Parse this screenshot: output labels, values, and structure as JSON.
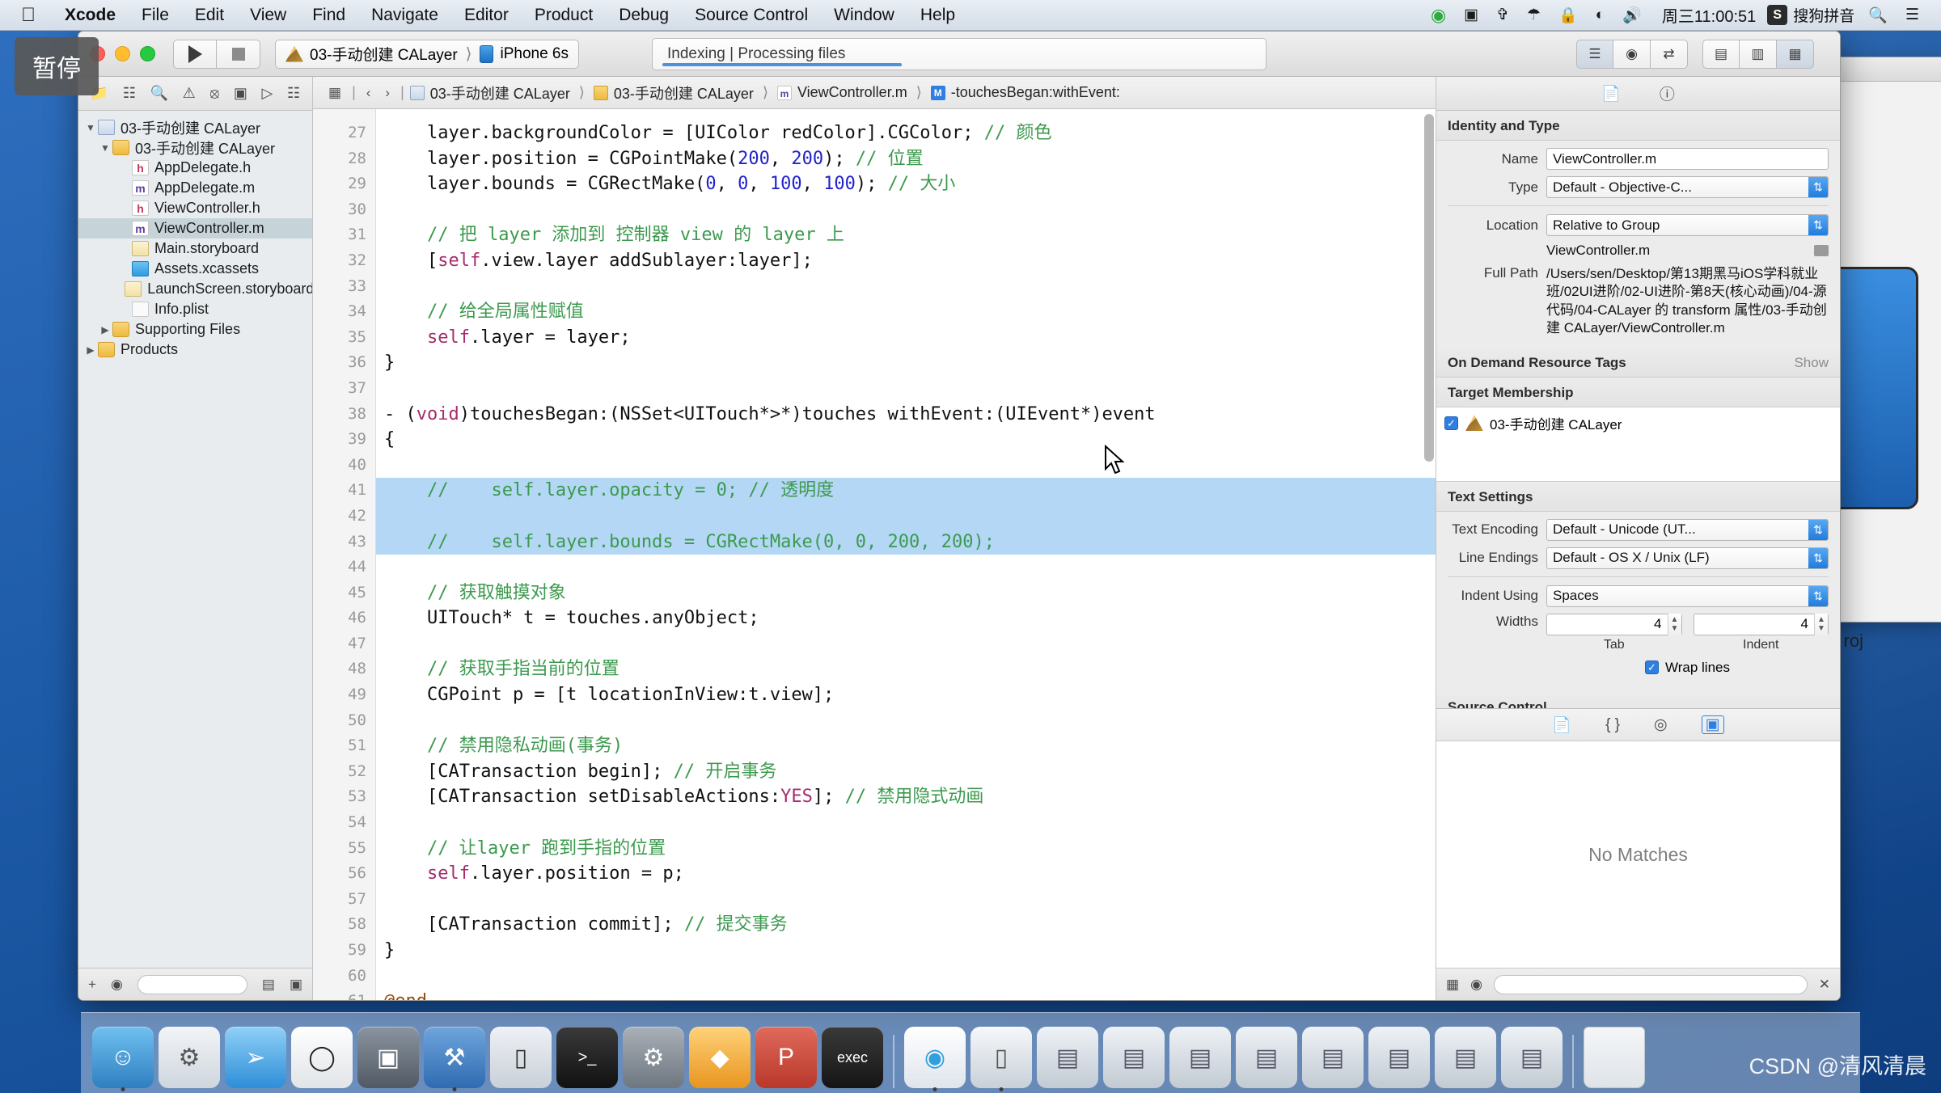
{
  "menubar": {
    "apple_icon": "apple-logo",
    "items": [
      {
        "label": "Xcode",
        "bold": true
      },
      {
        "label": "File",
        "bold": false
      },
      {
        "label": "Edit",
        "bold": false
      },
      {
        "label": "View",
        "bold": false
      },
      {
        "label": "Find",
        "bold": false
      },
      {
        "label": "Navigate",
        "bold": false
      },
      {
        "label": "Editor",
        "bold": false
      },
      {
        "label": "Product",
        "bold": false
      },
      {
        "label": "Debug",
        "bold": false
      },
      {
        "label": "Source Control",
        "bold": false
      },
      {
        "label": "Window",
        "bold": false
      },
      {
        "label": "Help",
        "bold": false
      }
    ],
    "status_icons": [
      "download-icon",
      "screen-record-icon",
      "airplay-icon",
      "bluetooth-icon",
      "lock-icon",
      "wifi-icon",
      "volume-icon"
    ],
    "clock": "周三11:00:51",
    "input_method_badge": "S",
    "input_method": "搜狗拼音",
    "search_icon": "search-icon",
    "control_center_icon": "list-icon"
  },
  "overlay": {
    "pause_label": "暂停"
  },
  "toolbar": {
    "run_icon": "play-icon",
    "stop_icon": "stop-icon",
    "scheme": "03-手动创建 CALayer",
    "scheme_separator": "⟩",
    "destination": "iPhone 6s",
    "status_primary": "Indexing",
    "status_divider": "|",
    "status_secondary": "Processing files",
    "progress_percent": 40,
    "right_segments": [
      {
        "icon": "standard-editor-icon",
        "active": true
      },
      {
        "icon": "assistant-editor-icon",
        "active": false
      },
      {
        "icon": "version-editor-icon",
        "active": false
      }
    ],
    "view_segments": [
      {
        "icon": "hide-navigator-icon",
        "active": false
      },
      {
        "icon": "hide-debug-area-icon",
        "active": false
      },
      {
        "icon": "hide-utilities-icon",
        "active": true
      }
    ]
  },
  "navigator": {
    "tabs": [
      {
        "icon": "folder-icon",
        "name": "project-navigator",
        "active": true
      },
      {
        "icon": "source-control-icon",
        "name": "source-control-navigator",
        "active": false
      },
      {
        "icon": "search-icon",
        "name": "find-navigator",
        "active": false
      },
      {
        "icon": "warning-icon",
        "name": "issue-navigator",
        "active": false
      },
      {
        "icon": "test-icon",
        "name": "test-navigator",
        "active": false
      },
      {
        "icon": "debug-icon",
        "name": "debug-navigator",
        "active": false
      },
      {
        "icon": "breakpoint-icon",
        "name": "breakpoint-navigator",
        "active": false
      },
      {
        "icon": "report-icon",
        "name": "report-navigator",
        "active": false
      }
    ],
    "tree": [
      {
        "label": "03-手动创建 CALayer",
        "indent": 0,
        "twisty": "▼",
        "icon": "proj",
        "glyph": "",
        "selected": false
      },
      {
        "label": "03-手动创建 CALayer",
        "indent": 1,
        "twisty": "▼",
        "icon": "folder",
        "glyph": "",
        "selected": false
      },
      {
        "label": "AppDelegate.h",
        "indent": 2,
        "twisty": "",
        "icon": "txt h",
        "glyph": "h",
        "selected": false
      },
      {
        "label": "AppDelegate.m",
        "indent": 2,
        "twisty": "",
        "icon": "txt m",
        "glyph": "m",
        "selected": false
      },
      {
        "label": "ViewController.h",
        "indent": 2,
        "twisty": "",
        "icon": "txt h",
        "glyph": "h",
        "selected": false
      },
      {
        "label": "ViewController.m",
        "indent": 2,
        "twisty": "",
        "icon": "txt m",
        "glyph": "m",
        "selected": true
      },
      {
        "label": "Main.storyboard",
        "indent": 2,
        "twisty": "",
        "icon": "sb",
        "glyph": "",
        "selected": false
      },
      {
        "label": "Assets.xcassets",
        "indent": 2,
        "twisty": "",
        "icon": "xc",
        "glyph": "",
        "selected": false
      },
      {
        "label": "LaunchScreen.storyboard",
        "indent": 2,
        "twisty": "",
        "icon": "sb",
        "glyph": "",
        "selected": false
      },
      {
        "label": "Info.plist",
        "indent": 2,
        "twisty": "",
        "icon": "plist",
        "glyph": "",
        "selected": false
      },
      {
        "label": "Supporting Files",
        "indent": 1,
        "twisty": "▶",
        "icon": "folder",
        "glyph": "",
        "selected": false
      },
      {
        "label": "Products",
        "indent": 0,
        "twisty": "▶",
        "icon": "folder",
        "glyph": "",
        "selected": false
      }
    ],
    "bottom": {
      "add_icon": "+",
      "filter_icon": "filter-icon",
      "filter_placeholder": "",
      "right_icons": [
        "recent-icon",
        "source-control-filter-icon"
      ]
    }
  },
  "jumpbar": {
    "related_icon": "related-files-icon",
    "back_icon": "‹",
    "forward_icon": "›",
    "crumbs": [
      {
        "label": "03-手动创建 CALayer",
        "icon": "proj",
        "glyph": ""
      },
      {
        "label": "03-手动创建 CALayer",
        "icon": "folder",
        "glyph": ""
      },
      {
        "label": "ViewController.m",
        "icon": "m",
        "glyph": "m"
      },
      {
        "label": "-touchesBegan:withEvent:",
        "icon": "meth",
        "glyph": "M"
      }
    ]
  },
  "editor": {
    "first_line_number": 27,
    "lines": [
      {
        "n": 27,
        "selected": false,
        "segments": [
          {
            "t": "    layer.backgroundColor = [UIColor redColor].CGColor; ",
            "c": ""
          },
          {
            "t": "// 颜色",
            "c": "cm"
          }
        ]
      },
      {
        "n": 28,
        "selected": false,
        "segments": [
          {
            "t": "    layer.position = CGPointMake(",
            "c": ""
          },
          {
            "t": "200",
            "c": "num"
          },
          {
            "t": ", ",
            "c": ""
          },
          {
            "t": "200",
            "c": "num"
          },
          {
            "t": "); ",
            "c": ""
          },
          {
            "t": "// 位置",
            "c": "cm"
          }
        ]
      },
      {
        "n": 29,
        "selected": false,
        "segments": [
          {
            "t": "    layer.bounds = CGRectMake(",
            "c": ""
          },
          {
            "t": "0",
            "c": "num"
          },
          {
            "t": ", ",
            "c": ""
          },
          {
            "t": "0",
            "c": "num"
          },
          {
            "t": ", ",
            "c": ""
          },
          {
            "t": "100",
            "c": "num"
          },
          {
            "t": ", ",
            "c": ""
          },
          {
            "t": "100",
            "c": "num"
          },
          {
            "t": "); ",
            "c": ""
          },
          {
            "t": "// 大小",
            "c": "cm"
          }
        ]
      },
      {
        "n": 30,
        "selected": false,
        "segments": [
          {
            "t": "",
            "c": ""
          }
        ]
      },
      {
        "n": 31,
        "selected": false,
        "segments": [
          {
            "t": "    // 把 layer 添加到 控制器 view 的 layer 上",
            "c": "cm"
          }
        ]
      },
      {
        "n": 32,
        "selected": false,
        "segments": [
          {
            "t": "    [",
            "c": ""
          },
          {
            "t": "self",
            "c": "kw"
          },
          {
            "t": ".view.layer addSublayer:layer];",
            "c": ""
          }
        ]
      },
      {
        "n": 33,
        "selected": false,
        "segments": [
          {
            "t": "",
            "c": ""
          }
        ]
      },
      {
        "n": 34,
        "selected": false,
        "segments": [
          {
            "t": "    // 给全局属性赋值",
            "c": "cm"
          }
        ]
      },
      {
        "n": 35,
        "selected": false,
        "segments": [
          {
            "t": "    ",
            "c": ""
          },
          {
            "t": "self",
            "c": "kw"
          },
          {
            "t": ".layer = layer;",
            "c": ""
          }
        ]
      },
      {
        "n": 36,
        "selected": false,
        "segments": [
          {
            "t": "}",
            "c": ""
          }
        ]
      },
      {
        "n": 37,
        "selected": false,
        "segments": [
          {
            "t": "",
            "c": ""
          }
        ]
      },
      {
        "n": 38,
        "selected": false,
        "segments": [
          {
            "t": "- (",
            "c": ""
          },
          {
            "t": "void",
            "c": "kw"
          },
          {
            "t": ")touchesBegan:(NSSet<UITouch*>*)touches withEvent:(UIEvent*)event",
            "c": ""
          }
        ]
      },
      {
        "n": 39,
        "selected": false,
        "segments": [
          {
            "t": "{",
            "c": ""
          }
        ]
      },
      {
        "n": 40,
        "selected": false,
        "segments": [
          {
            "t": "",
            "c": ""
          }
        ]
      },
      {
        "n": 41,
        "selected": true,
        "segments": [
          {
            "t": "    //    self.layer.opacity = 0; // 透明度",
            "c": "cm"
          }
        ]
      },
      {
        "n": 42,
        "selected": true,
        "segments": [
          {
            "t": "",
            "c": ""
          }
        ]
      },
      {
        "n": 43,
        "selected": true,
        "segments": [
          {
            "t": "    //    self.layer.bounds = CGRectMake(0, 0, 200, 200);",
            "c": "cm"
          }
        ]
      },
      {
        "n": 44,
        "selected": false,
        "segments": [
          {
            "t": "",
            "c": ""
          }
        ]
      },
      {
        "n": 45,
        "selected": false,
        "segments": [
          {
            "t": "    // 获取触摸对象",
            "c": "cm"
          }
        ]
      },
      {
        "n": 46,
        "selected": false,
        "segments": [
          {
            "t": "    UITouch* t = touches.anyObject;",
            "c": ""
          }
        ]
      },
      {
        "n": 47,
        "selected": false,
        "segments": [
          {
            "t": "",
            "c": ""
          }
        ]
      },
      {
        "n": 48,
        "selected": false,
        "segments": [
          {
            "t": "    // 获取手指当前的位置",
            "c": "cm"
          }
        ]
      },
      {
        "n": 49,
        "selected": false,
        "segments": [
          {
            "t": "    CGPoint p = [t locationInView:t.view];",
            "c": ""
          }
        ]
      },
      {
        "n": 50,
        "selected": false,
        "segments": [
          {
            "t": "",
            "c": ""
          }
        ]
      },
      {
        "n": 51,
        "selected": false,
        "segments": [
          {
            "t": "    // 禁用隐私动画(事务)",
            "c": "cm"
          }
        ]
      },
      {
        "n": 52,
        "selected": false,
        "segments": [
          {
            "t": "    [CATransaction begin]; ",
            "c": ""
          },
          {
            "t": "// 开启事务",
            "c": "cm"
          }
        ]
      },
      {
        "n": 53,
        "selected": false,
        "segments": [
          {
            "t": "    [CATransaction setDisableActions:",
            "c": ""
          },
          {
            "t": "YES",
            "c": "kw"
          },
          {
            "t": "]; ",
            "c": ""
          },
          {
            "t": "// 禁用隐式动画",
            "c": "cm"
          }
        ]
      },
      {
        "n": 54,
        "selected": false,
        "segments": [
          {
            "t": "",
            "c": ""
          }
        ]
      },
      {
        "n": 55,
        "selected": false,
        "segments": [
          {
            "t": "    // 让layer 跑到手指的位置",
            "c": "cm"
          }
        ]
      },
      {
        "n": 56,
        "selected": false,
        "segments": [
          {
            "t": "    ",
            "c": ""
          },
          {
            "t": "self",
            "c": "kw"
          },
          {
            "t": ".layer.position = p;",
            "c": ""
          }
        ]
      },
      {
        "n": 57,
        "selected": false,
        "segments": [
          {
            "t": "",
            "c": ""
          }
        ]
      },
      {
        "n": 58,
        "selected": false,
        "segments": [
          {
            "t": "    [CATransaction commit]; ",
            "c": ""
          },
          {
            "t": "// 提交事务",
            "c": "cm"
          }
        ]
      },
      {
        "n": 59,
        "selected": false,
        "segments": [
          {
            "t": "}",
            "c": ""
          }
        ]
      },
      {
        "n": 60,
        "selected": false,
        "segments": [
          {
            "t": "",
            "c": ""
          }
        ]
      },
      {
        "n": 61,
        "selected": false,
        "segments": [
          {
            "t": "@end",
            "c": "pre"
          }
        ]
      }
    ]
  },
  "inspector": {
    "tabs": [
      "file-inspector-icon",
      "quick-help-icon"
    ],
    "identity": {
      "title": "Identity and Type",
      "name_label": "Name",
      "name_value": "ViewController.m",
      "type_label": "Type",
      "type_value": "Default - Objective-C...",
      "location_label": "Location",
      "location_value": "Relative to Group",
      "location_file": "ViewController.m",
      "full_path_label": "Full Path",
      "full_path_value": "/Users/sen/Desktop/第13期黑马iOS学科就业班/02UI进阶/02-UI进阶-第8天(核心动画)/04-源代码/04-CALayer 的 transform 属性/03-手动创建 CALayer/ViewController.m"
    },
    "odr": {
      "title": "On Demand Resource Tags",
      "show_label": "Show"
    },
    "target_membership": {
      "title": "Target Membership",
      "items": [
        {
          "label": "03-手动创建 CALayer",
          "checked": true
        }
      ]
    },
    "text_settings": {
      "title": "Text Settings",
      "encoding_label": "Text Encoding",
      "encoding_value": "Default - Unicode (UT...",
      "line_endings_label": "Line Endings",
      "line_endings_value": "Default - OS X / Unix (LF)",
      "indent_label": "Indent Using",
      "indent_value": "Spaces",
      "widths_label": "Widths",
      "tab_value": "4",
      "tab_sub": "Tab",
      "indent_value_num": "4",
      "indent_sub": "Indent",
      "wrap_label": "Wrap lines",
      "wrap_checked": true
    },
    "source_control": {
      "title": "Source Control"
    }
  },
  "library": {
    "tabs": [
      {
        "icon": "file-template-library-icon",
        "active": false
      },
      {
        "icon": "code-snippet-library-icon",
        "active": false
      },
      {
        "icon": "object-library-icon",
        "active": false
      },
      {
        "icon": "media-library-icon",
        "active": true
      }
    ],
    "empty_message": "No Matches",
    "bottom_icons": [
      "grid-view-icon",
      "info-icon",
      "close-icon"
    ],
    "filter_placeholder": ""
  },
  "background": {
    "project_label": "roj"
  },
  "dock": {
    "items": [
      {
        "name": "finder",
        "glyph": "☺",
        "color": "#2f8fe0",
        "running": true
      },
      {
        "name": "launchpad",
        "glyph": "🚀",
        "color": "#d8dde4",
        "running": false
      },
      {
        "name": "safari",
        "glyph": "🧭",
        "color": "#46a6ef",
        "running": false
      },
      {
        "name": "clock-app",
        "glyph": "🕐",
        "color": "#f5f5f5",
        "running": false
      },
      {
        "name": "video-player",
        "glyph": "🎬",
        "color": "#6f7b88",
        "running": false
      },
      {
        "name": "xcode",
        "glyph": "🔨",
        "color": "#4b88c8",
        "running": true
      },
      {
        "name": "simulator",
        "glyph": "📱",
        "color": "#dfe4ea",
        "running": false
      },
      {
        "name": "terminal",
        "glyph": "▶_",
        "color": "#1c1c1c",
        "running": false
      },
      {
        "name": "system-preferences",
        "glyph": "⚙",
        "color": "#8d939b",
        "running": false
      },
      {
        "name": "sketch",
        "glyph": "◆",
        "color": "#f0a830",
        "running": false
      },
      {
        "name": "paw",
        "glyph": "P",
        "color": "#cf4b3e",
        "running": false
      },
      {
        "name": "exec-app",
        "glyph": "⌨",
        "color": "#2b2b2b",
        "running": false
      },
      {
        "name": "browser-360",
        "glyph": "◉",
        "color": "#2f9fe0",
        "running": true
      },
      {
        "name": "window-app",
        "glyph": "▭",
        "color": "#cfd5db",
        "running": true
      },
      {
        "name": "minimized-window-1",
        "glyph": "▤",
        "color": "#c8ced5",
        "running": false
      },
      {
        "name": "minimized-window-2",
        "glyph": "▤",
        "color": "#c8ced5",
        "running": false
      },
      {
        "name": "minimized-window-3",
        "glyph": "▤",
        "color": "#c8ced5",
        "running": false
      },
      {
        "name": "minimized-window-4",
        "glyph": "▤",
        "color": "#c8ced5",
        "running": false
      },
      {
        "name": "minimized-window-5",
        "glyph": "▤",
        "color": "#c8ced5",
        "running": false
      },
      {
        "name": "minimized-window-6",
        "glyph": "▤",
        "color": "#c8ced5",
        "running": false
      },
      {
        "name": "minimized-window-7",
        "glyph": "▤",
        "color": "#c8ced5",
        "running": false
      },
      {
        "name": "minimized-window-8",
        "glyph": "▤",
        "color": "#c8ced5",
        "running": false
      }
    ],
    "trash_name": "trash"
  },
  "watermark": "CSDN @清风清晨"
}
